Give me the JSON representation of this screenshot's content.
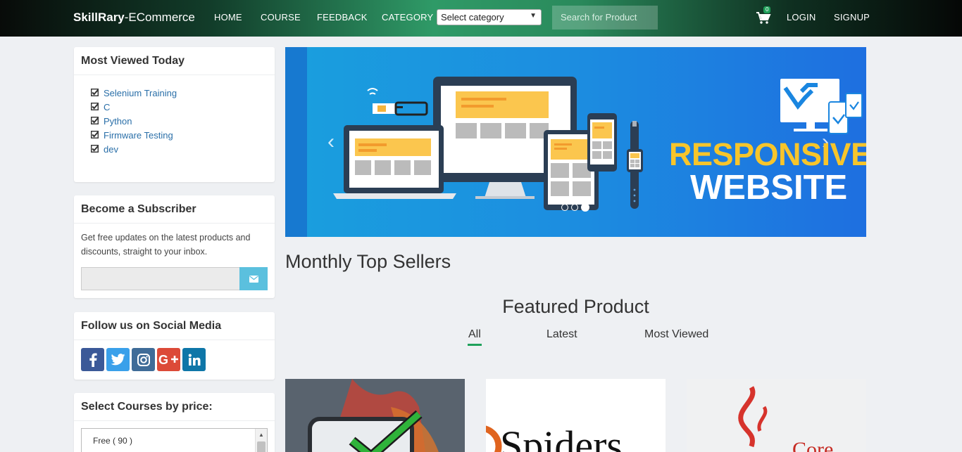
{
  "brand": {
    "bold": "SkillRary",
    "rest": "-ECommerce"
  },
  "nav": {
    "home": "HOME",
    "course": "COURSE",
    "feedback": "FEEDBACK",
    "category": "CATEGORY",
    "category_select": "Select category",
    "search_placeholder": "Search for Product",
    "cart_count": "0",
    "login": "LOGIN",
    "signup": "SIGNUP"
  },
  "most_viewed": {
    "title": "Most Viewed Today",
    "items": [
      "Selenium Training",
      "C",
      "Python",
      "Firmware Testing",
      "dev"
    ]
  },
  "subscriber": {
    "title": "Become a Subscriber",
    "text": "Get free updates on the latest products and discounts, straight to your inbox."
  },
  "social": {
    "title": "Follow us on Social Media",
    "networks": [
      "facebook",
      "twitter",
      "instagram",
      "google-plus",
      "linkedin"
    ],
    "colors": {
      "facebook": "#3b5998",
      "twitter": "#3aa0ea",
      "instagram": "#3f6c98",
      "google-plus": "#dc4a38",
      "linkedin": "#0e76a8"
    }
  },
  "price_filter": {
    "title": "Select Courses by price:",
    "options": [
      "Free ( 90 )"
    ]
  },
  "banner": {
    "line1": "RESPONSIVE",
    "line2": "WEBSITE",
    "slides": 3,
    "active_slide": 3
  },
  "main": {
    "section_title": "Monthly Top Sellers",
    "featured_title": "Featured Product",
    "tabs": [
      "All",
      "Latest",
      "Most Viewed"
    ],
    "active_tab": "All"
  },
  "colors": {
    "accent": "#1fa15a",
    "link": "#2a6fa8",
    "subscribe_button": "#5bc0de"
  }
}
